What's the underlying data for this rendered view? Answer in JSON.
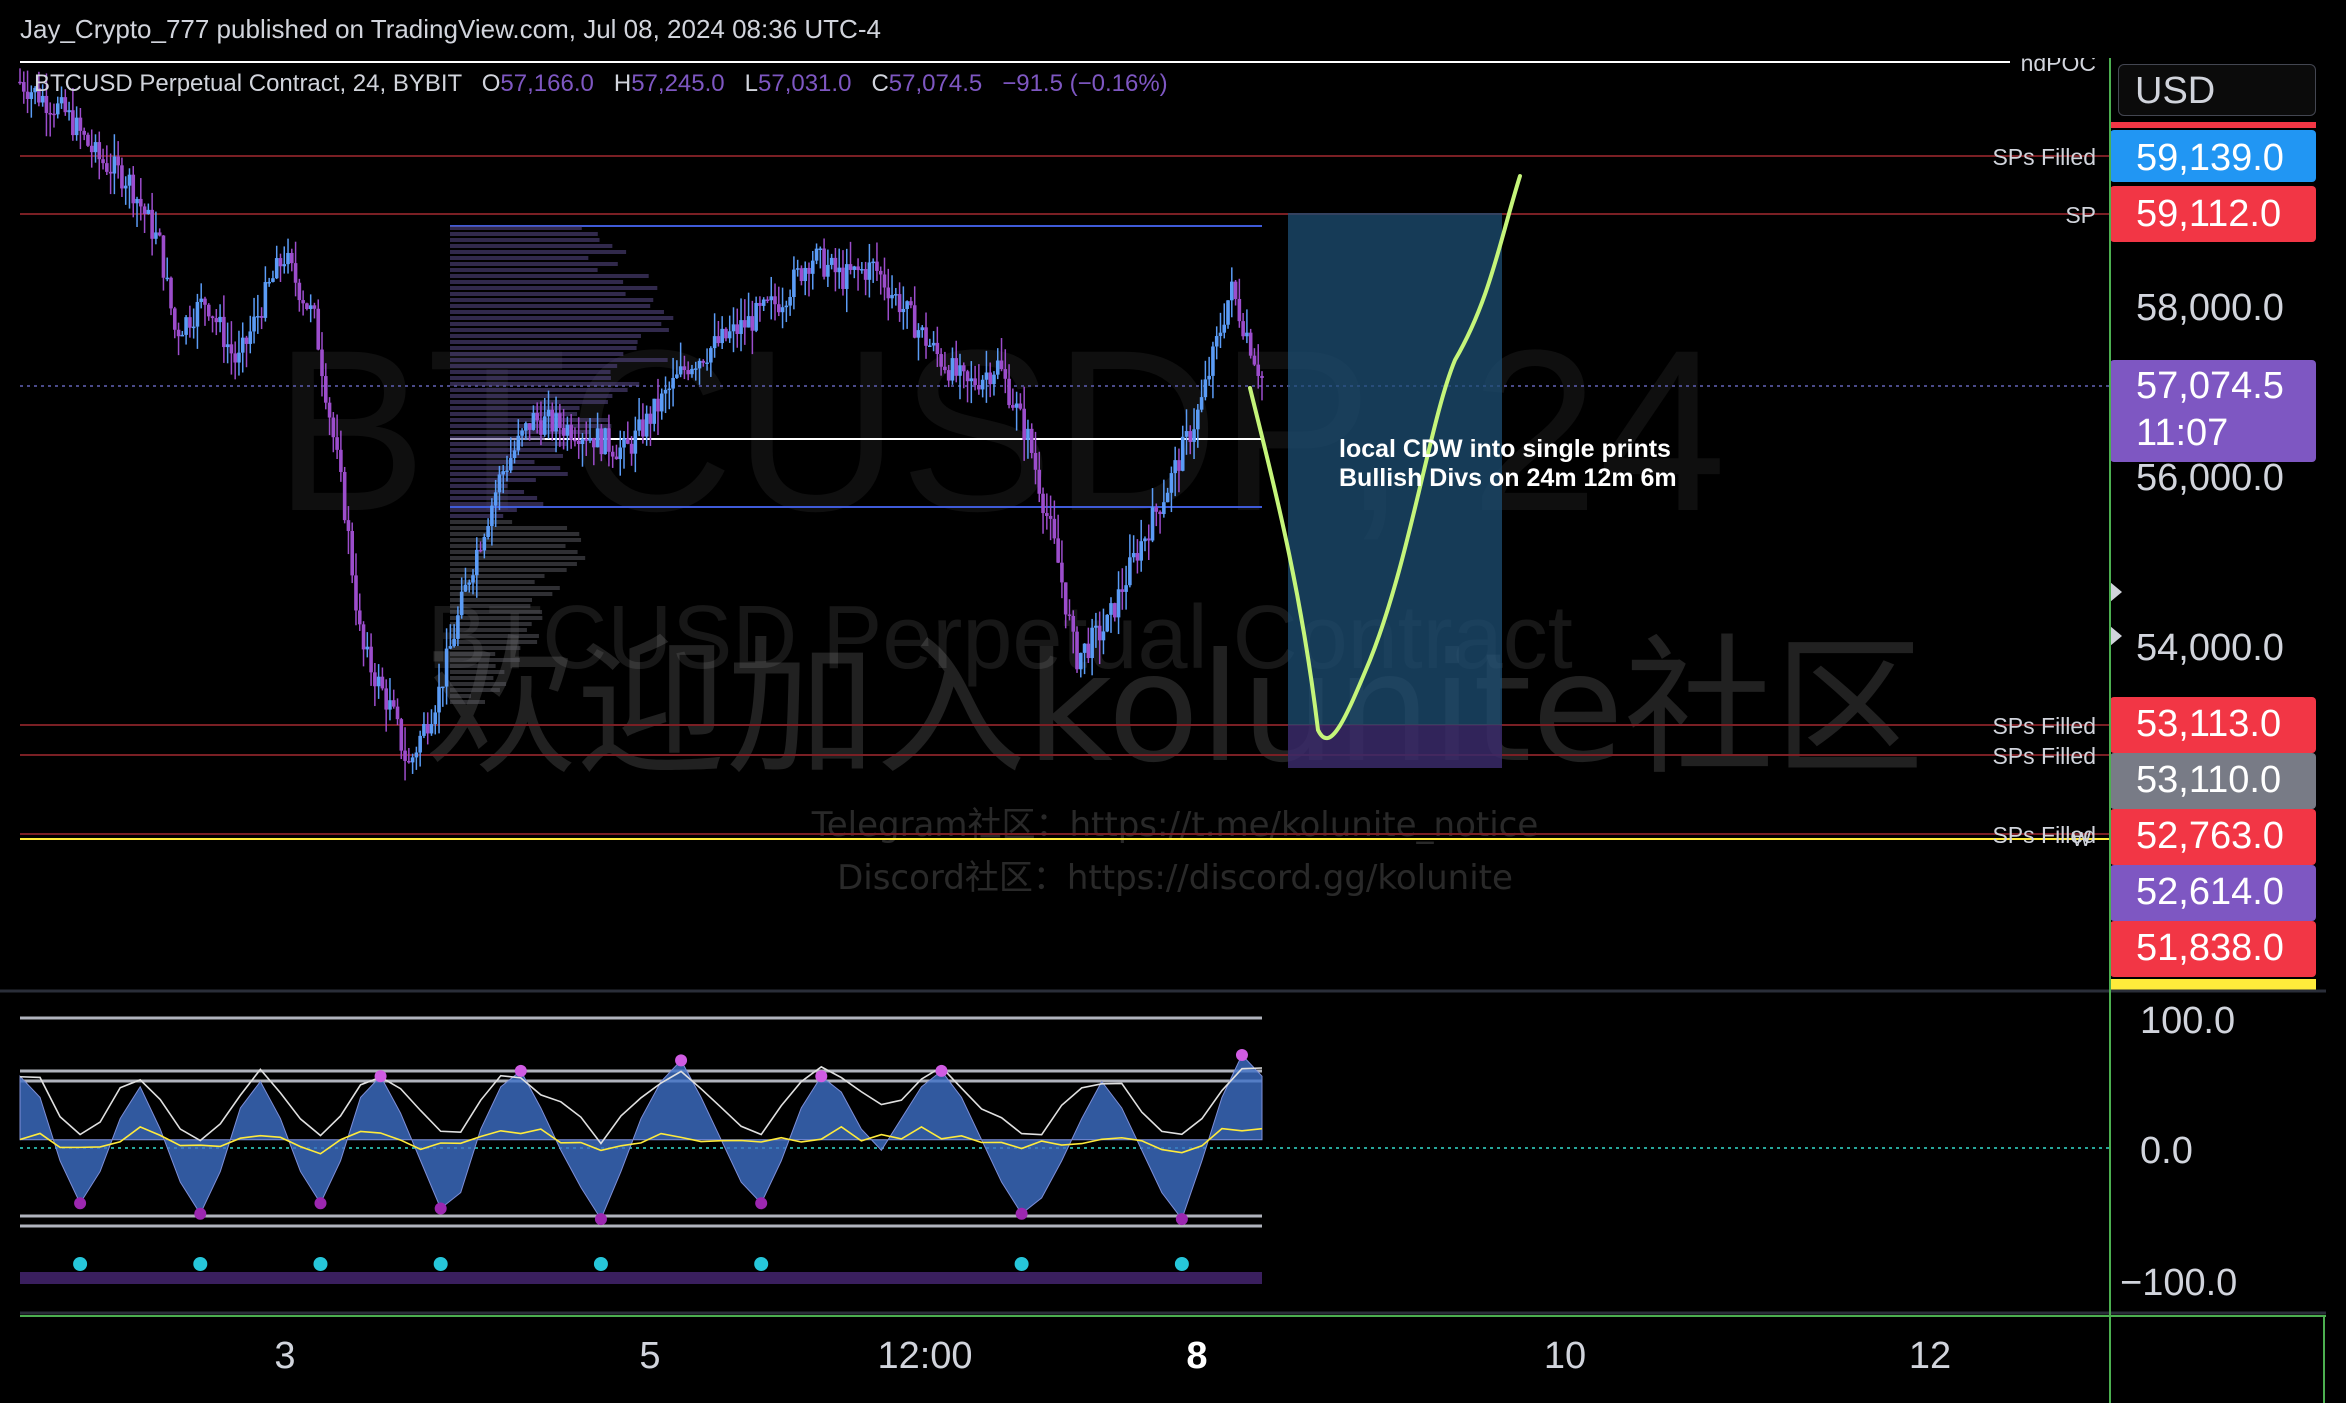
{
  "header": {
    "published": "Jay_Crypto_777 published on TradingView.com, Jul 08, 2024 08:36 UTC-4",
    "symbol": "BTCUSD Perpetual Contract, 24, BYBIT",
    "o_label": "O",
    "o_value": "57,166.0",
    "h_label": "H",
    "h_value": "57,245.0",
    "l_label": "L",
    "l_value": "57,031.0",
    "c_label": "C",
    "c_value": "57,074.5",
    "change": "−91.5 (−0.16%)",
    "currency_button": "USD"
  },
  "watermark": {
    "big": "欢迎加入kolunite社区",
    "ticker": "BTCUSDP, 24",
    "contract": "BTCUSD Perpetual Contract",
    "telegram": "Telegram社区：https://t.me/kolunite_notice",
    "discord": "Discord社区：https://discord.gg/kolunite"
  },
  "annotation": {
    "line1": "local CDW into single prints",
    "line2": "Bullish Divs on 24m  12m 6m"
  },
  "colors": {
    "bull": "#5b9cf6",
    "bear": "#9c4dcc",
    "purple": "#7e57c2",
    "red": "#f23645",
    "blue": "#2196f3",
    "gray": "#787b86",
    "yellow": "#ffeb3b",
    "green": "#4caf50",
    "path": "#c5f57a"
  },
  "chart_data": [
    {
      "type": "candlestick",
      "x_ticks": [
        "3",
        "5",
        "12:00",
        "8",
        "10",
        "12"
      ],
      "y_ticks": [
        {
          "label": "58,000.0",
          "value": 58000
        },
        {
          "label": "56,000.0",
          "value": 56000
        },
        {
          "label": "54,000.0",
          "value": 54000
        }
      ],
      "ylim": [
        51500,
        60000
      ],
      "price_path_approx": [
        [
          0,
          59800
        ],
        [
          0.03,
          59500
        ],
        [
          0.05,
          59100
        ],
        [
          0.07,
          58900
        ],
        [
          0.09,
          58300
        ],
        [
          0.1,
          57500
        ],
        [
          0.12,
          57800
        ],
        [
          0.14,
          57200
        ],
        [
          0.16,
          57900
        ],
        [
          0.17,
          58200
        ],
        [
          0.19,
          57600
        ],
        [
          0.2,
          56700
        ],
        [
          0.21,
          55800
        ],
        [
          0.22,
          54600
        ],
        [
          0.24,
          54000
        ],
        [
          0.25,
          53500
        ],
        [
          0.27,
          54200
        ],
        [
          0.29,
          55300
        ],
        [
          0.31,
          56200
        ],
        [
          0.33,
          56700
        ],
        [
          0.36,
          56600
        ],
        [
          0.39,
          56400
        ],
        [
          0.41,
          56800
        ],
        [
          0.43,
          57200
        ],
        [
          0.45,
          57400
        ],
        [
          0.47,
          57600
        ],
        [
          0.49,
          57800
        ],
        [
          0.51,
          58200
        ],
        [
          0.53,
          58000
        ],
        [
          0.55,
          58100
        ],
        [
          0.57,
          57700
        ],
        [
          0.59,
          57300
        ],
        [
          0.61,
          57000
        ],
        [
          0.63,
          57200
        ],
        [
          0.65,
          56500
        ],
        [
          0.67,
          55300
        ],
        [
          0.68,
          54500
        ],
        [
          0.7,
          54800
        ],
        [
          0.72,
          55500
        ],
        [
          0.74,
          56100
        ],
        [
          0.76,
          56800
        ],
        [
          0.78,
          57900
        ],
        [
          0.79,
          57500
        ],
        [
          0.8,
          57074.5
        ]
      ],
      "levels": [
        {
          "label": "ndPOC",
          "value": 59950,
          "color": "#ffffff"
        },
        {
          "label": "SPs Filled",
          "price": "59,139.0",
          "value": 59139,
          "color": "#2196f3"
        },
        {
          "label": "SP",
          "price": "59,112.0",
          "value": 59112,
          "color": "#f23645"
        },
        {
          "label": "",
          "price": "57,074.5",
          "time": "11:07",
          "value": 57074.5,
          "color": "#7e57c2"
        },
        {
          "label": "SPs Filled",
          "price": "53,113.0",
          "value": 53113,
          "color": "#f23645"
        },
        {
          "label": "SPs Filled",
          "price": "53,110.0",
          "value": 53110,
          "color": "#787b86"
        },
        {
          "label": "SPs Filled",
          "price": "52,763.0",
          "value": 52763,
          "color": "#f23645"
        },
        {
          "label": "",
          "price": "52,614.0",
          "value": 52614,
          "color": "#7e57c2"
        },
        {
          "label": "",
          "price": "51,838.0",
          "value": 51838,
          "color": "#f23645"
        }
      ],
      "w_marker": "W"
    },
    {
      "type": "oscillator",
      "y_ticks": [
        {
          "label": "100.0",
          "value": 100
        },
        {
          "label": "0.0",
          "value": 0
        },
        {
          "label": "−100.0",
          "value": -100
        }
      ],
      "ylim": [
        -125,
        115
      ],
      "wave_approx": [
        60,
        40,
        -20,
        -60,
        -30,
        20,
        50,
        10,
        -40,
        -70,
        -30,
        30,
        55,
        20,
        -30,
        -60,
        -20,
        40,
        60,
        25,
        -20,
        -65,
        -50,
        10,
        50,
        65,
        30,
        -10,
        -45,
        -75,
        -30,
        20,
        55,
        75,
        40,
        0,
        -40,
        -60,
        -20,
        30,
        60,
        45,
        10,
        -10,
        20,
        50,
        65,
        40,
        0,
        -40,
        -70,
        -55,
        -20,
        20,
        55,
        30,
        -10,
        -50,
        -75,
        -20,
        40,
        80,
        60
      ]
    }
  ]
}
